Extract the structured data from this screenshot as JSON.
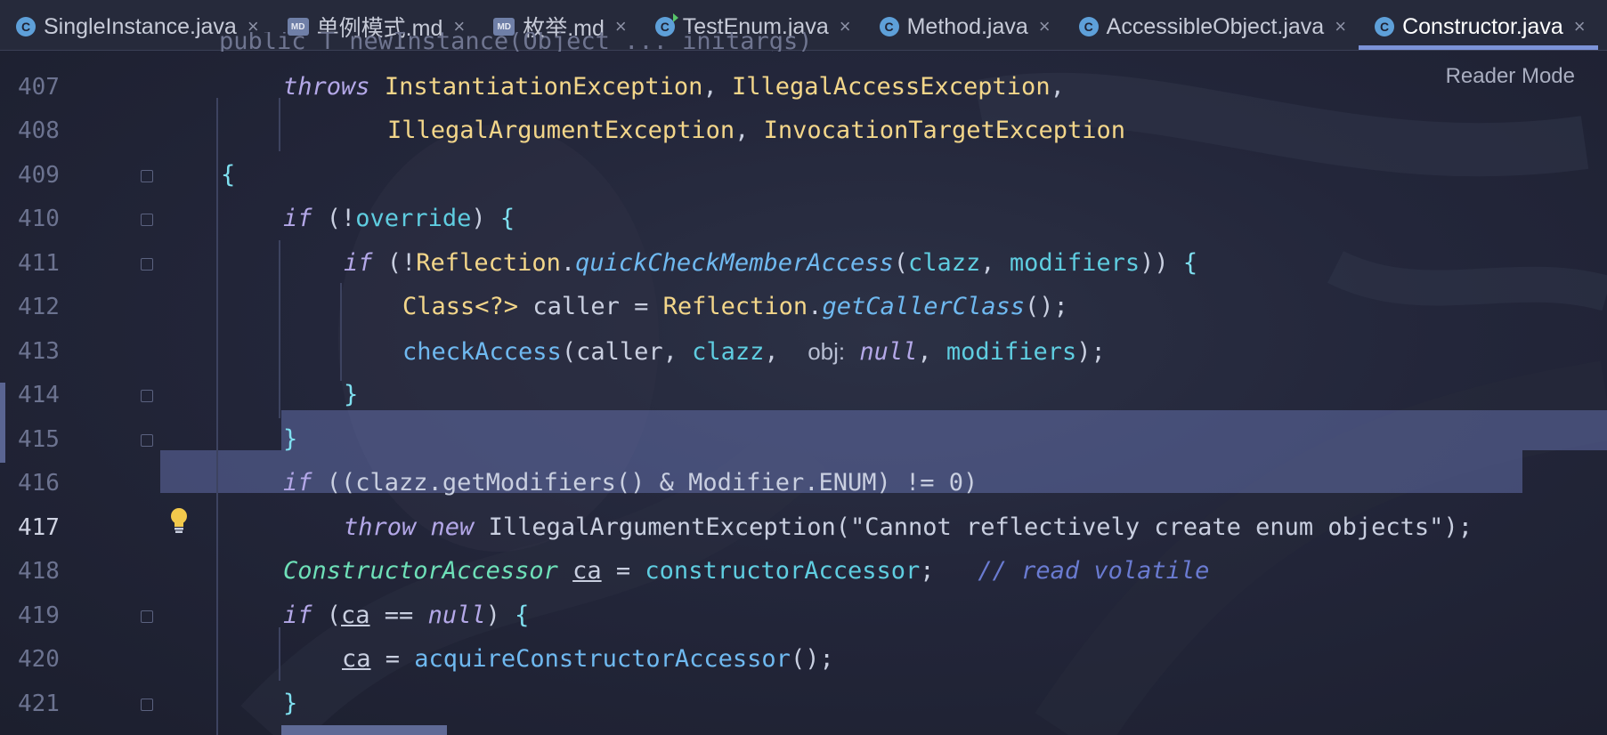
{
  "tabs": [
    {
      "label": "SingleInstance.java",
      "icon": "class-file-icon",
      "icon_glyph": "C",
      "active": false
    },
    {
      "label": "单例模式.md",
      "icon": "markdown-file-icon",
      "icon_glyph": "MD",
      "active": false
    },
    {
      "label": "枚举.md",
      "icon": "markdown-file-icon",
      "icon_glyph": "MD",
      "active": false
    },
    {
      "label": "TestEnum.java",
      "icon": "runnable-class-icon",
      "icon_glyph": "C",
      "active": false
    },
    {
      "label": "Method.java",
      "icon": "class-file-icon",
      "icon_glyph": "C",
      "active": false
    },
    {
      "label": "AccessibleObject.java",
      "icon": "class-file-icon",
      "icon_glyph": "C",
      "active": false
    },
    {
      "label": "Constructor.java",
      "icon": "class-file-icon",
      "icon_glyph": "C",
      "active": true
    }
  ],
  "close_glyph": "×",
  "reader_mode": "Reader Mode",
  "partial_top_line": "public T newInstance(Object ... initargs)",
  "line_numbers": [
    "407",
    "408",
    "409",
    "410",
    "411",
    "412",
    "413",
    "414",
    "415",
    "416",
    "417",
    "418",
    "419",
    "420",
    "421"
  ],
  "current_line": "417",
  "code": {
    "l407": {
      "kw": "throws",
      "t1": "InstantiationException",
      "c1": ", ",
      "t2": "IllegalAccessException",
      "c2": ","
    },
    "l408": {
      "t1": "IllegalArgumentException",
      "c1": ", ",
      "t2": "InvocationTargetException"
    },
    "l409": {
      "b": "{"
    },
    "l410": {
      "kw": "if",
      "p1": " (!",
      "f": "override",
      "p2": ") ",
      "b": "{"
    },
    "l411": {
      "kw": "if",
      "p1": " (!",
      "ty": "Reflection",
      "dot": ".",
      "fn": "quickCheckMemberAccess",
      "p2": "(",
      "f1": "clazz",
      "c": ", ",
      "f2": "modifiers",
      "p3": ")) ",
      "b": "{"
    },
    "l412": {
      "ty": "Class",
      "gen": "<?>",
      "p1": " caller = ",
      "ty2": "Reflection",
      "dot": ".",
      "fn": "getCallerClass",
      "p2": "();"
    },
    "l413": {
      "fn": "checkAccess",
      "p1": "(caller, ",
      "f1": "clazz",
      "c1": ", ",
      "hint": "obj:",
      "kw": "null",
      "c2": ", ",
      "f2": "modifiers",
      "p2": ");"
    },
    "l414": {
      "b": "}"
    },
    "l415": {
      "b": "}"
    },
    "l416": {
      "kw": "if",
      "rest": " ((clazz.getModifiers() & Modifier.ENUM) != 0)"
    },
    "l417": {
      "kw1": "throw",
      "kw2": "new",
      "rest": " IllegalArgumentException(\"Cannot reflectively create enum objects\");"
    },
    "l418": {
      "ty": "ConstructorAccessor",
      "v": "ca",
      "p1": " = ",
      "f": "constructorAccessor",
      "p2": ";   ",
      "cmt": "// read volatile"
    },
    "l419": {
      "kw": "if",
      "p1": " (",
      "v": "ca",
      "p2": " == ",
      "kw2": "null",
      "p3": ") ",
      "b": "{"
    },
    "l420": {
      "v": "ca",
      "p1": " = ",
      "fn": "acquireConstructorAccessor",
      "p2": "();"
    },
    "l421": {
      "b": "}"
    }
  }
}
